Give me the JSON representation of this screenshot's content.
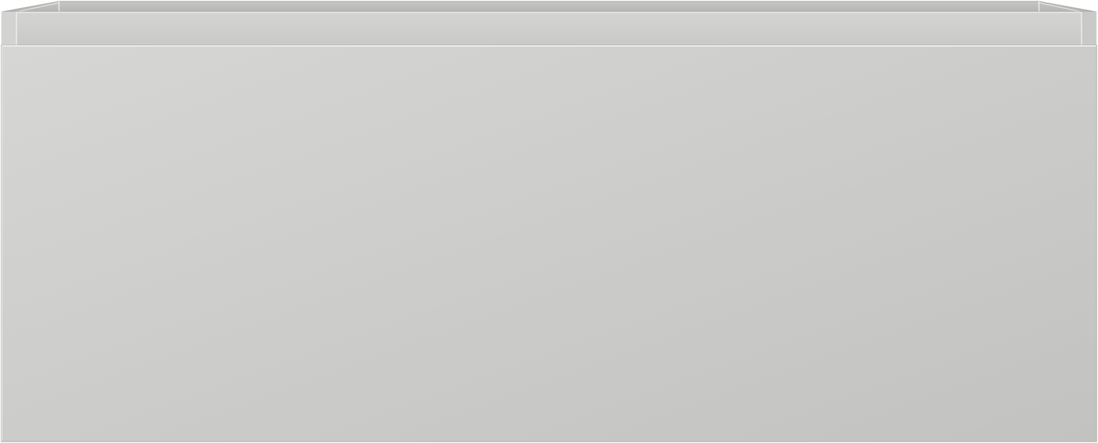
{
  "object": {
    "kind": "drawer-front",
    "colors": {
      "front_light": "#d6d6d4",
      "front_dark": "#c2c2c0",
      "rim": "#d0d0ce",
      "inner_wall": "#bdbdbb",
      "inner_wall_dark": "#b3b3b1",
      "edge_highlight": "#eeeeec",
      "edge_shadow": "#a9a9a7",
      "background": "#ffffff"
    }
  }
}
